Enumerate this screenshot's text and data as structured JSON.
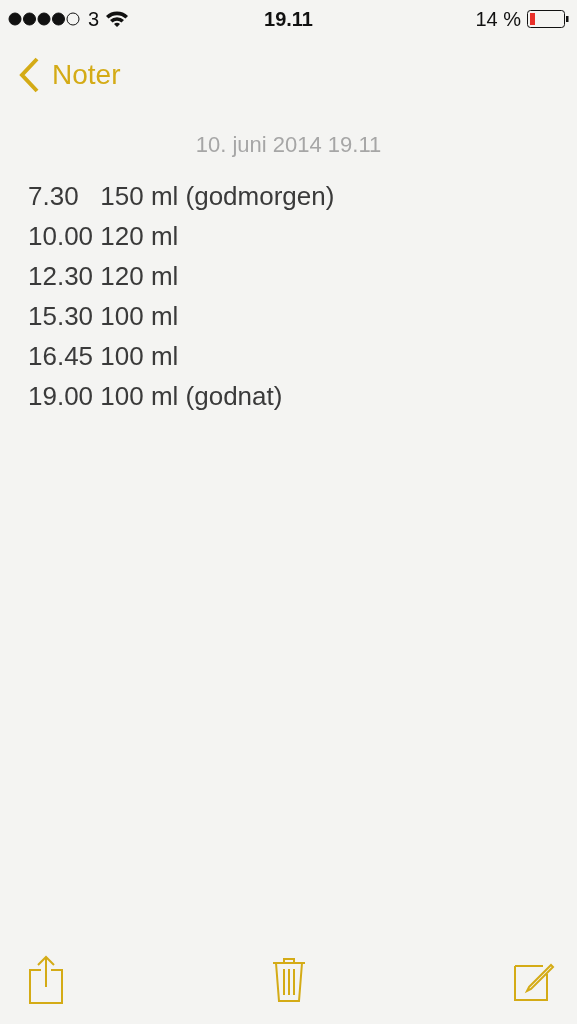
{
  "status_bar": {
    "carrier": "3",
    "time": "19.11",
    "battery": "14 %"
  },
  "nav": {
    "back": "Noter"
  },
  "note": {
    "date": "10. juni 2014 19.11",
    "lines": [
      "7.30   150 ml (godmorgen)",
      "10.00 120 ml",
      "12.30 120 ml",
      "15.30 100 ml",
      "16.45 100 ml",
      "19.00 100 ml (godnat)"
    ]
  }
}
